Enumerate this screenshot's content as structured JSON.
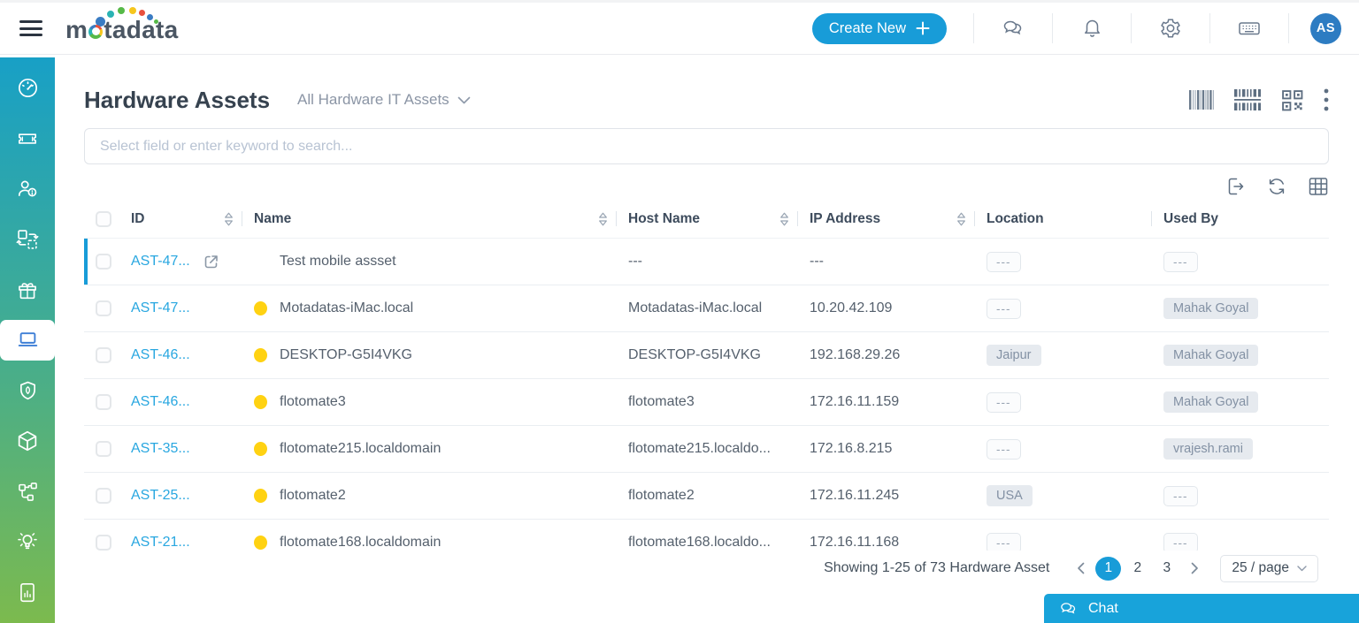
{
  "topbar": {
    "logo_text": "motadata",
    "logo_render": {
      "pre": "m",
      "post": "tadata"
    },
    "create_button_label": "Create New",
    "avatar_initials": "AS",
    "icons": [
      "chat-icon",
      "notifications-icon",
      "settings-icon",
      "keyboard-icon"
    ]
  },
  "sidebar": {
    "items": [
      {
        "icon": "dashboard-icon",
        "active": false
      },
      {
        "icon": "ticket-icon",
        "active": false
      },
      {
        "icon": "users-icon",
        "active": false
      },
      {
        "icon": "change-icon",
        "active": false
      },
      {
        "icon": "release-icon",
        "active": false
      },
      {
        "icon": "assets-icon",
        "active": true
      },
      {
        "icon": "security-icon",
        "active": false
      },
      {
        "icon": "package-icon",
        "active": false
      },
      {
        "icon": "topology-icon",
        "active": false
      },
      {
        "icon": "idea-icon",
        "active": false
      },
      {
        "icon": "reports-icon",
        "active": false
      }
    ]
  },
  "page": {
    "title": "Hardware Assets",
    "view_filter": "All Hardware IT Assets",
    "search_placeholder": "Select field or enter keyword to search...",
    "header_icons": [
      "barcode-icon",
      "scan-barcode-icon",
      "qr-code-icon",
      "more-menu-icon"
    ],
    "toolbar_icons": [
      "export-icon",
      "refresh-icon",
      "column-grid-icon"
    ]
  },
  "table": {
    "columns": [
      "ID",
      "Name",
      "Host Name",
      "IP Address",
      "Location",
      "Used By"
    ],
    "sortable_columns": [
      "ID",
      "Name",
      "Host Name",
      "IP Address"
    ],
    "rows": [
      {
        "id": "AST-47...",
        "selected": true,
        "show_open_icon": true,
        "has_dot": false,
        "name": "Test mobile assset",
        "host": "---",
        "ip": "---",
        "location": "---",
        "location_style": "empty",
        "used_by": "---",
        "used_by_style": "empty"
      },
      {
        "id": "AST-47...",
        "selected": false,
        "show_open_icon": false,
        "has_dot": true,
        "name": "Motadatas-iMac.local",
        "host": "Motadatas-iMac.local",
        "ip": "10.20.42.109",
        "location": "---",
        "location_style": "empty",
        "used_by": "Mahak Goyal",
        "used_by_style": "filled"
      },
      {
        "id": "AST-46...",
        "selected": false,
        "show_open_icon": false,
        "has_dot": true,
        "name": "DESKTOP-G5I4VKG",
        "host": "DESKTOP-G5I4VKG",
        "ip": "192.168.29.26",
        "location": "Jaipur",
        "location_style": "filled",
        "used_by": "Mahak Goyal",
        "used_by_style": "filled"
      },
      {
        "id": "AST-46...",
        "selected": false,
        "show_open_icon": false,
        "has_dot": true,
        "name": "flotomate3",
        "host": "flotomate3",
        "ip": "172.16.11.159",
        "location": "---",
        "location_style": "empty",
        "used_by": "Mahak Goyal",
        "used_by_style": "filled"
      },
      {
        "id": "AST-35...",
        "selected": false,
        "show_open_icon": false,
        "has_dot": true,
        "name": "flotomate215.localdomain",
        "host": "flotomate215.localdo...",
        "ip": "172.16.8.215",
        "location": "---",
        "location_style": "empty",
        "used_by": "vrajesh.rami",
        "used_by_style": "filled"
      },
      {
        "id": "AST-25...",
        "selected": false,
        "show_open_icon": false,
        "has_dot": true,
        "name": "flotomate2",
        "host": "flotomate2",
        "ip": "172.16.11.245",
        "location": "USA",
        "location_style": "filled",
        "used_by": "---",
        "used_by_style": "empty"
      },
      {
        "id": "AST-21...",
        "selected": false,
        "show_open_icon": false,
        "has_dot": true,
        "name": "flotomate168.localdomain",
        "host": "flotomate168.localdo...",
        "ip": "172.16.11.168",
        "location": "---",
        "location_style": "empty",
        "used_by": "---",
        "used_by_style": "empty"
      }
    ]
  },
  "pagination": {
    "summary": "Showing 1-25 of 73 Hardware Asset",
    "pages": [
      "1",
      "2",
      "3"
    ],
    "active_page": "1",
    "page_size_label": "25 / page"
  },
  "chat": {
    "label": "Chat"
  },
  "colors": {
    "accent_blue": "#189CD8",
    "link_blue": "#29A7E0",
    "status_yellow": "#FFD212",
    "sidebar_gradient_top": "#18A0C6",
    "sidebar_gradient_bottom": "#7CBA4E",
    "avatar_blue": "#2D7CC2",
    "chat_bar_blue": "#18A3DA"
  }
}
